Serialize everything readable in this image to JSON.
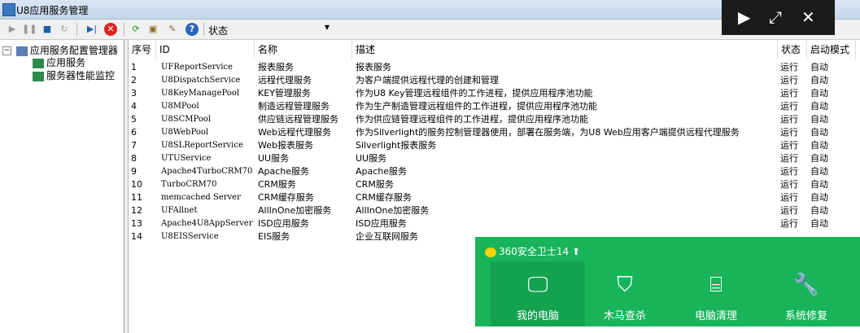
{
  "window": {
    "title": "U8应用服务管理"
  },
  "toolbar": {
    "status_label": "状态",
    "status_value": ""
  },
  "media_controls": {
    "play": "▶",
    "resize": "⤢",
    "close": "✕"
  },
  "tree": {
    "root": "应用服务配置管理器",
    "children": [
      "应用服务",
      "服务器性能监控"
    ]
  },
  "table": {
    "columns": [
      "序号",
      "ID",
      "名称",
      "描述",
      "状态",
      "启动模式"
    ],
    "rows": [
      {
        "no": "1",
        "id": "UFReportService",
        "name": "报表服务",
        "desc": "报表服务",
        "status": "运行",
        "mode": "自动"
      },
      {
        "no": "2",
        "id": "U8DispatchService",
        "name": "远程代理服务",
        "desc": "为客户端提供远程代理的创建和管理",
        "status": "运行",
        "mode": "自动"
      },
      {
        "no": "3",
        "id": "U8KeyManagePool",
        "name": "KEY管理服务",
        "desc": "作为U8 Key管理远程组件的工作进程，提供应用程序池功能",
        "status": "运行",
        "mode": "自动"
      },
      {
        "no": "4",
        "id": "U8MPool",
        "name": "制造远程管理服务",
        "desc": "作为生产制造管理远程组件的工作进程，提供应用程序池功能",
        "status": "运行",
        "mode": "自动"
      },
      {
        "no": "5",
        "id": "U8SCMPool",
        "name": "供应链远程管理服务",
        "desc": "作为供应链管理远程组件的工作进程，提供应用程序池功能",
        "status": "运行",
        "mode": "自动"
      },
      {
        "no": "6",
        "id": "U8WebPool",
        "name": "Web远程代理服务",
        "desc": "作为Silverlight的服务控制管理器使用，部署在服务端，为U8 Web应用客户端提供远程代理服务",
        "status": "运行",
        "mode": "自动"
      },
      {
        "no": "7",
        "id": "U8SLReportService",
        "name": "Web报表服务",
        "desc": "Silverlight报表服务",
        "status": "运行",
        "mode": "自动"
      },
      {
        "no": "8",
        "id": "UTUService",
        "name": "UU服务",
        "desc": "UU服务",
        "status": "运行",
        "mode": "自动"
      },
      {
        "no": "9",
        "id": "Apache4TurboCRM70",
        "name": "Apache服务",
        "desc": "Apache服务",
        "status": "运行",
        "mode": "自动"
      },
      {
        "no": "10",
        "id": "TurboCRM70",
        "name": "CRM服务",
        "desc": "CRM服务",
        "status": "运行",
        "mode": "自动"
      },
      {
        "no": "11",
        "id": "memcached Server",
        "name": "CRM缓存服务",
        "desc": "CRM缓存服务",
        "status": "运行",
        "mode": "自动"
      },
      {
        "no": "12",
        "id": "UFAllnet",
        "name": "AllInOne加密服务",
        "desc": "AllInOne加密服务",
        "status": "运行",
        "mode": "自动"
      },
      {
        "no": "13",
        "id": "Apache4U8AppServer",
        "name": "ISD应用服务",
        "desc": "ISD应用服务",
        "status": "运行",
        "mode": "自动"
      },
      {
        "no": "14",
        "id": "U8EISService",
        "name": "EIS服务",
        "desc": "企业互联网服务",
        "status": "",
        "mode": ""
      }
    ]
  },
  "popup": {
    "brand": "360安全卫士14",
    "items": [
      {
        "label": "我的电脑",
        "icon": "monitor-icon"
      },
      {
        "label": "木马查杀",
        "icon": "shield-icon"
      },
      {
        "label": "电脑清理",
        "icon": "broom-icon"
      },
      {
        "label": "系统修复",
        "icon": "wrench-icon"
      }
    ]
  }
}
